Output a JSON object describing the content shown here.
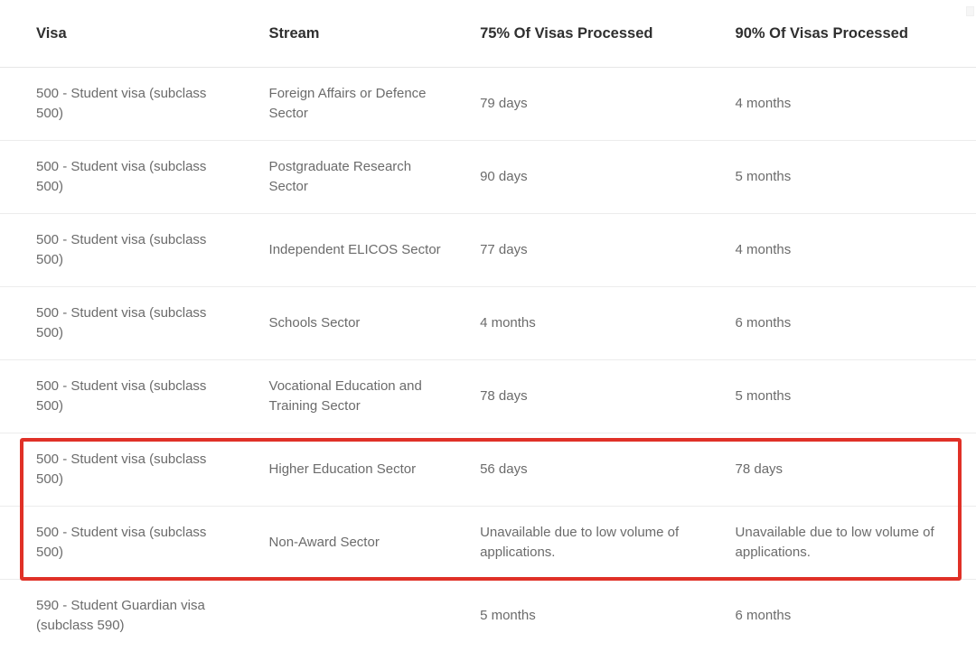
{
  "table": {
    "columns": [
      {
        "key": "visa",
        "label": "Visa"
      },
      {
        "key": "stream",
        "label": "Stream"
      },
      {
        "key": "p75",
        "label": "75% Of Visas Processed"
      },
      {
        "key": "p90",
        "label": "90% Of Visas Processed"
      }
    ],
    "rows": [
      {
        "visa": "500 - Student visa (subclass 500)",
        "stream": "Foreign Affairs or Defence Sector",
        "p75": "79 days",
        "p90": "4 months",
        "highlighted": false
      },
      {
        "visa": "500 - Student visa (subclass 500)",
        "stream": "Postgraduate Research Sector",
        "p75": "90 days",
        "p90": "5 months",
        "highlighted": false
      },
      {
        "visa": "500 - Student visa (subclass 500)",
        "stream": "Independent ELICOS Sector",
        "p75": "77 days",
        "p90": "4 months",
        "highlighted": false
      },
      {
        "visa": "500 - Student visa (subclass 500)",
        "stream": "Schools Sector",
        "p75": "4 months",
        "p90": "6 months",
        "highlighted": false
      },
      {
        "visa": "500 - Student visa (subclass 500)",
        "stream": "Vocational Education and Training Sector",
        "p75": "78 days",
        "p90": "5 months",
        "highlighted": false
      },
      {
        "visa": "500 - Student visa (subclass 500)",
        "stream": "Higher Education Sector",
        "p75": "56 days",
        "p90": "78 days",
        "highlighted": true
      },
      {
        "visa": "500 - Student visa (subclass 500)",
        "stream": "Non-Award Sector",
        "p75": "Unavailable due to low volume of applications.",
        "p90": "Unavailable due to low volume of applications.",
        "highlighted": true
      },
      {
        "visa": "590 - Student Guardian visa (subclass 590)",
        "stream": "",
        "p75": "5 months",
        "p90": "6 months",
        "highlighted": false
      }
    ]
  },
  "annotation": {
    "type": "highlight-rectangle",
    "color": "#e03127",
    "covers_rows": [
      6,
      7
    ]
  },
  "colors": {
    "header_text": "#2f2f2f",
    "body_text": "#6b6b6b",
    "row_divider": "#ececec",
    "header_divider": "#e6e6e6",
    "background": "#ffffff",
    "highlight": "#e03127"
  }
}
